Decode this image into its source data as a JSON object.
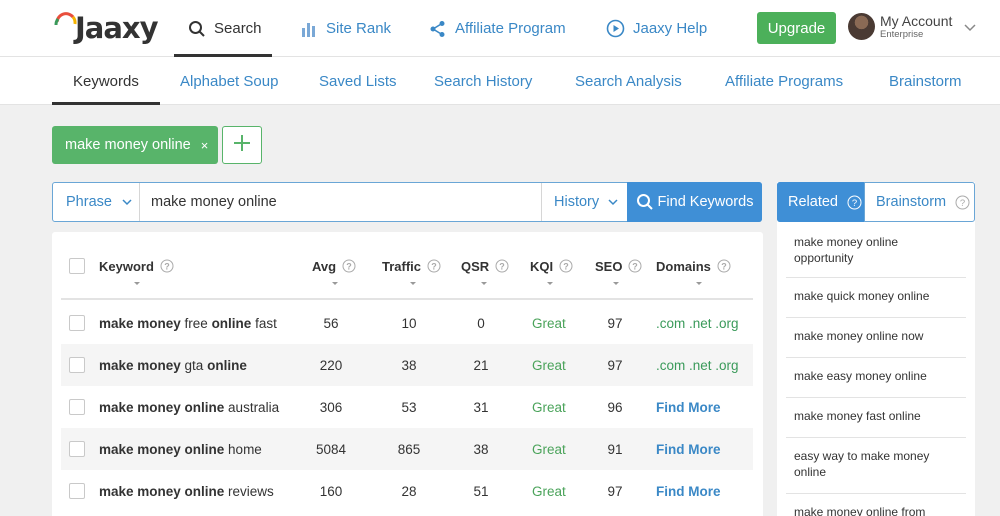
{
  "header": {
    "logo_text": "Jaaxy",
    "nav": [
      {
        "label": "Search",
        "icon": "search-icon",
        "active": true
      },
      {
        "label": "Site Rank",
        "icon": "bar-chart-icon"
      },
      {
        "label": "Affiliate Program",
        "icon": "share-icon"
      },
      {
        "label": "Jaaxy Help",
        "icon": "play-circle-icon"
      }
    ],
    "upgrade_label": "Upgrade",
    "account": {
      "name": "My Account",
      "plan": "Enterprise"
    }
  },
  "subnav": [
    {
      "label": "Keywords",
      "active": true
    },
    {
      "label": "Alphabet Soup"
    },
    {
      "label": "Saved Lists"
    },
    {
      "label": "Search History"
    },
    {
      "label": "Search Analysis"
    },
    {
      "label": "Affiliate Programs"
    },
    {
      "label": "Brainstorm"
    }
  ],
  "tag": {
    "label": "make money online",
    "remove": "×"
  },
  "search": {
    "mode": "Phrase",
    "value": "make money online",
    "history_label": "History",
    "button_label": "Find Keywords"
  },
  "table": {
    "columns": [
      "Keyword",
      "Avg",
      "Traffic",
      "QSR",
      "KQI",
      "SEO",
      "Domains"
    ],
    "rows": [
      {
        "kw_a": "make money",
        "kw_b": " free ",
        "kw_c": "online",
        "kw_d": " fast",
        "avg": "56",
        "traffic": "10",
        "qsr": "0",
        "kqi": "Great",
        "seo": "97",
        "domains": ".com .net .org"
      },
      {
        "kw_a": "make money",
        "kw_b": " gta ",
        "kw_c": "online",
        "kw_d": "",
        "avg": "220",
        "traffic": "38",
        "qsr": "21",
        "kqi": "Great",
        "seo": "97",
        "domains": ".com .net .org"
      },
      {
        "kw_a": "make money online",
        "kw_b": " australia",
        "kw_c": "",
        "kw_d": "",
        "avg": "306",
        "traffic": "53",
        "qsr": "31",
        "kqi": "Great",
        "seo": "96",
        "domains": "Find More"
      },
      {
        "kw_a": "make money online",
        "kw_b": " home",
        "kw_c": "",
        "kw_d": "",
        "avg": "5084",
        "traffic": "865",
        "qsr": "38",
        "kqi": "Great",
        "seo": "91",
        "domains": "Find More"
      },
      {
        "kw_a": "make money online",
        "kw_b": " reviews",
        "kw_c": "",
        "kw_d": "",
        "avg": "160",
        "traffic": "28",
        "qsr": "51",
        "kqi": "Great",
        "seo": "97",
        "domains": "Find More"
      }
    ]
  },
  "sidebar": {
    "tabs": [
      "Related",
      "Brainstorm"
    ],
    "related": [
      "make money online opportunity",
      "make quick money online",
      "make money online now",
      "make easy money online",
      "make money fast online",
      "easy way to make money online",
      "make money online from"
    ]
  },
  "colors": {
    "brand_blue": "#3f8fd6",
    "link_blue": "#3a88c6",
    "green": "#4cb05a",
    "kqi_great": "#4aa35a"
  }
}
